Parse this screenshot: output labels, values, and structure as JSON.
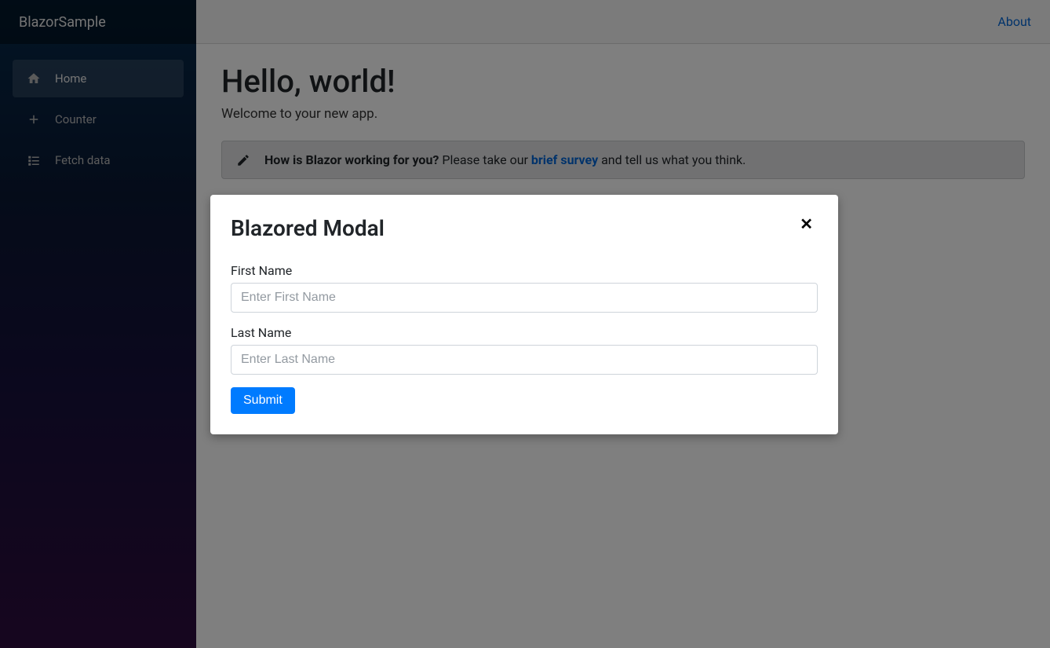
{
  "sidebar": {
    "brand": "BlazorSample",
    "items": [
      {
        "label": "Home"
      },
      {
        "label": "Counter"
      },
      {
        "label": "Fetch data"
      }
    ]
  },
  "header": {
    "about_link": "About"
  },
  "main": {
    "heading": "Hello, world!",
    "welcome": "Welcome to your new app.",
    "survey": {
      "question": "How is Blazor working for you?",
      "prompt_prefix": " Please take our ",
      "link_text": "brief survey",
      "prompt_suffix": " and tell us what you think."
    }
  },
  "modal": {
    "title": "Blazored Modal",
    "close_glyph": "✕",
    "fields": {
      "first_name": {
        "label": "First Name",
        "placeholder": "Enter First Name",
        "value": ""
      },
      "last_name": {
        "label": "Last Name",
        "placeholder": "Enter Last Name",
        "value": ""
      }
    },
    "submit_label": "Submit"
  }
}
